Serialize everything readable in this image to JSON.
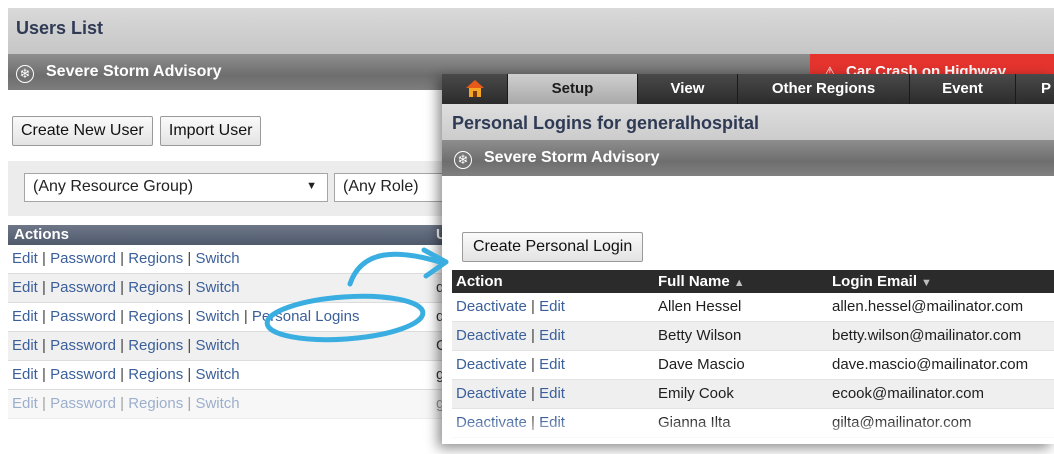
{
  "background_window": {
    "title": "Users List",
    "advisory": "Severe Storm Advisory",
    "alert_banner": "Car Crash on Highway",
    "buttons": {
      "create_new_user": "Create New User",
      "import_user": "Import User"
    },
    "filters": {
      "resource_group": "(Any Resource Group)",
      "role": "(Any Role)"
    },
    "table_header": {
      "actions": "Actions",
      "col2_peek": "U"
    },
    "rows": [
      {
        "actions": [
          "Edit",
          "Password",
          "Regions",
          "Switch"
        ],
        "peek": ""
      },
      {
        "actions": [
          "Edit",
          "Password",
          "Regions",
          "Switch"
        ],
        "peek": "d"
      },
      {
        "actions": [
          "Edit",
          "Password",
          "Regions",
          "Switch",
          "Personal Logins"
        ],
        "peek": "d"
      },
      {
        "actions": [
          "Edit",
          "Password",
          "Regions",
          "Switch"
        ],
        "peek": "G"
      },
      {
        "actions": [
          "Edit",
          "Password",
          "Regions",
          "Switch"
        ],
        "peek": "g"
      },
      {
        "actions": [
          "Edit",
          "Password",
          "Regions",
          "Switch"
        ],
        "peek": "g"
      }
    ]
  },
  "foreground_window": {
    "nav": [
      "Setup",
      "View",
      "Other Regions",
      "Event",
      "P"
    ],
    "active_nav": "Setup",
    "title": "Personal Logins for generalhospital",
    "advisory": "Severe Storm Advisory",
    "create_button": "Create Personal Login",
    "table_header": {
      "action": "Action",
      "full_name": "Full Name",
      "login_email": "Login Email"
    },
    "rows": [
      {
        "actions": [
          "Deactivate",
          "Edit"
        ],
        "name": "Allen Hessel",
        "email": "allen.hessel@mailinator.com"
      },
      {
        "actions": [
          "Deactivate",
          "Edit"
        ],
        "name": "Betty Wilson",
        "email": "betty.wilson@mailinator.com"
      },
      {
        "actions": [
          "Deactivate",
          "Edit"
        ],
        "name": "Dave Mascio",
        "email": "dave.mascio@mailinator.com"
      },
      {
        "actions": [
          "Deactivate",
          "Edit"
        ],
        "name": "Emily Cook",
        "email": "ecook@mailinator.com"
      },
      {
        "actions": [
          "Deactivate",
          "Edit"
        ],
        "name": "Gianna Ilta",
        "email": "gilta@mailinator.com"
      }
    ]
  },
  "colors": {
    "link": "#3a5f9a",
    "alert": "#e5332e",
    "highlight": "#3aaee0",
    "nav_bg": "#2b2b2b"
  },
  "icons": {
    "advisory": "snowflake-icon",
    "home": "home-icon",
    "alert": "warning-icon",
    "sort_asc": "sort-asc-icon",
    "sort_desc": "sort-desc-icon"
  }
}
